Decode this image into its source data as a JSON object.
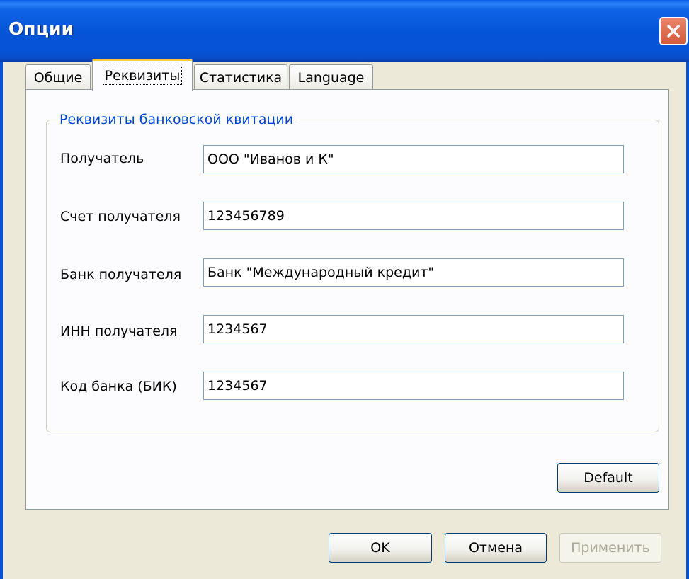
{
  "window": {
    "title": "Опции",
    "close_icon": "close-icon"
  },
  "tabs": [
    {
      "label": "Общие",
      "active": false
    },
    {
      "label": "Реквизиты",
      "active": true
    },
    {
      "label": "Статистика",
      "active": false
    },
    {
      "label": "Language",
      "active": false
    }
  ],
  "group": {
    "title": "Реквизиты банковской квитации"
  },
  "fields": [
    {
      "label": "Получатель",
      "value": "ООО \"Иванов и К\""
    },
    {
      "label": "Счет получателя",
      "value": "123456789"
    },
    {
      "label": "Банк получателя",
      "value": "Банк \"Международный кредит\""
    },
    {
      "label": "ИНН получателя",
      "value": "1234567"
    },
    {
      "label": "Код банка (БИК)",
      "value": "1234567"
    }
  ],
  "buttons": {
    "default": "Default",
    "ok": "OK",
    "cancel": "Отмена",
    "apply": "Применить",
    "apply_enabled": false
  },
  "colors": {
    "titlebar": "#0553d6",
    "group_title": "#0046d5",
    "active_tab_accent": "#ffc83c",
    "close_button": "#d35a3a"
  }
}
